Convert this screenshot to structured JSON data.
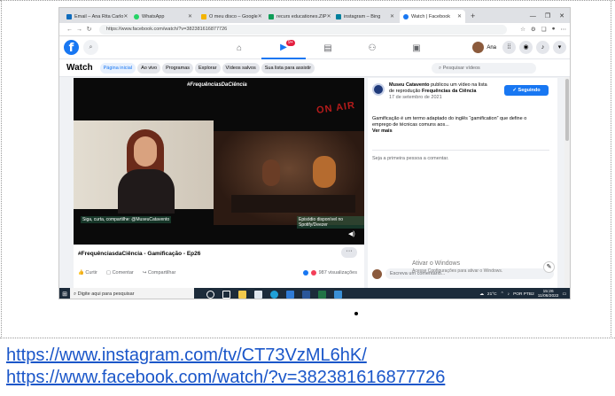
{
  "browser": {
    "tabs": [
      {
        "label": "Email – Ana Rita Carlo",
        "color": "#0f6cbd"
      },
      {
        "label": "WhatsApp",
        "color": "#25d366"
      },
      {
        "label": "O meu disco – Google",
        "color": "#f4b400"
      },
      {
        "label": "recurs educationes.ZIP",
        "color": "#0f9d58"
      },
      {
        "label": "instagram – Bing",
        "color": "#00809d"
      },
      {
        "label": "Watch | Facebook",
        "color": "#1877f2"
      }
    ],
    "url": "https://www.facebook.com/watch/?v=382381616877726"
  },
  "facebook": {
    "logo": "f",
    "nav_badge": "9+",
    "profile_name": "Ana"
  },
  "watch": {
    "title": "Watch",
    "tabs": [
      "Página inicial",
      "Ao vivo",
      "Programas",
      "Explorar",
      "Vídeos salvos",
      "Sua lista para assistir"
    ],
    "search_placeholder": "Pesquisar vídeos"
  },
  "video": {
    "hashtag_overlay": "#FrequênciasDaCiência",
    "on_air": "ON AIR",
    "caption_left": "Siga, curta, compartilhe: @MuseuCatavento",
    "caption_right": "Episódio disponível no Spotify/Deezer",
    "title": "#FrequênciasdaCiência - Gamificação - Ep26",
    "actions": {
      "like": "Curtir",
      "comment": "Comentar",
      "share": "Compartilhar"
    },
    "views": "987 visualizações",
    "reaction_colors": [
      "#1877f2",
      "#f33e58"
    ]
  },
  "side": {
    "page_name": "Museu Catavento",
    "post_action": "publicou um vídeo na lista de reprodução",
    "playlist": "Frequências da Ciência",
    "date": "17 de setembro de 2021",
    "follow_label": "Seguindo",
    "body": "Gamificação é um termo adaptado do inglês “gamification” que define o emprego de técnicas comuns aos...",
    "see_more": "Ver mais",
    "first_comment": "Seja a primeira pessoa a comentar.",
    "comment_placeholder": "Escreva um comentário...",
    "activate_title": "Ativar o Windows",
    "activate_sub": "Acesse Configurações para ativar o Windows."
  },
  "taskbar": {
    "search_placeholder": "Digite aqui para pesquisar",
    "temperature": "21°C",
    "lang": "POR PTB2",
    "time": "15:26",
    "date": "11/06/2022"
  },
  "links": [
    "https://www.instagram.com/tv/CT73VzML6hK/",
    "https://www.facebook.com/watch/?v=382381616877726"
  ]
}
